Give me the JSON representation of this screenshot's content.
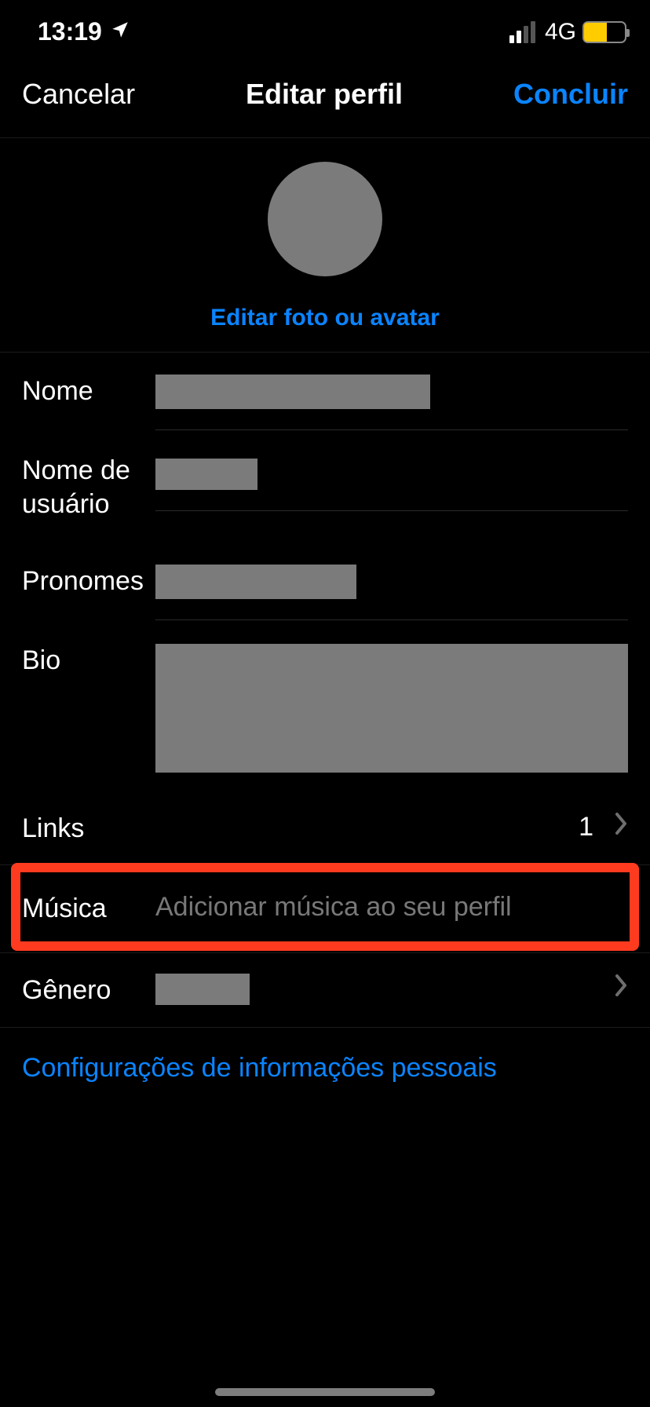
{
  "status": {
    "time": "13:19",
    "network": "4G"
  },
  "nav": {
    "cancel": "Cancelar",
    "title": "Editar perfil",
    "done": "Concluir"
  },
  "avatar": {
    "edit_label": "Editar foto ou avatar"
  },
  "fields": {
    "name": {
      "label": "Nome"
    },
    "username": {
      "label": "Nome de usuário"
    },
    "pronouns": {
      "label": "Pronomes"
    },
    "bio": {
      "label": "Bio"
    },
    "links": {
      "label": "Links",
      "count": "1"
    },
    "music": {
      "label": "Música",
      "placeholder": "Adicionar música ao seu perfil"
    },
    "gender": {
      "label": "Gênero"
    }
  },
  "personal_info": "Configurações de informações pessoais"
}
